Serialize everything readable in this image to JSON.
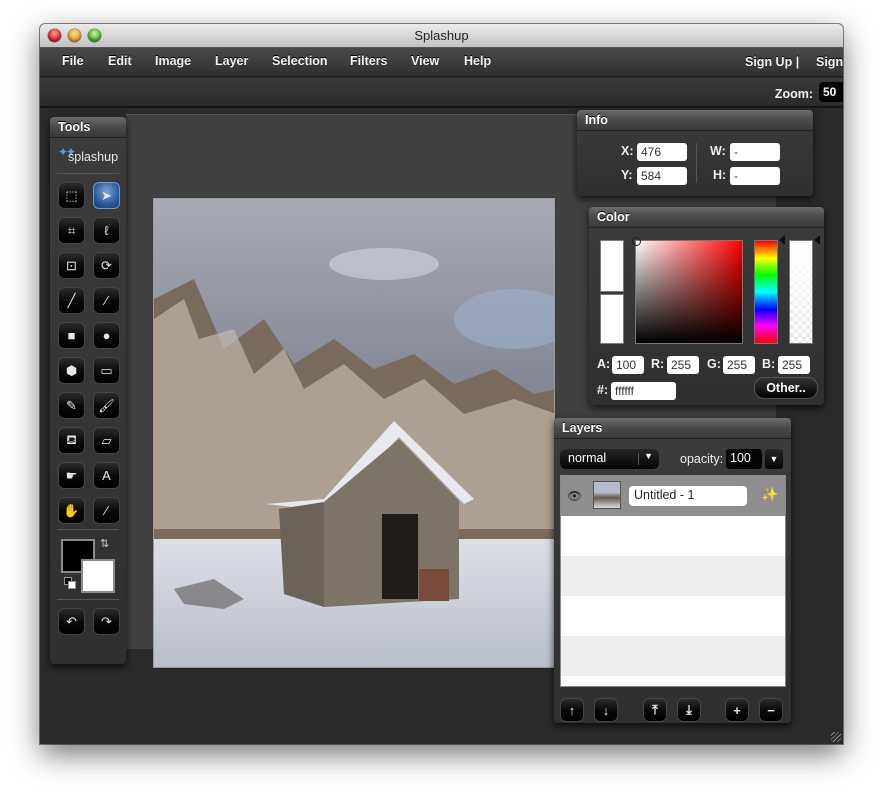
{
  "window": {
    "title": "Splashup"
  },
  "menu": {
    "items": [
      {
        "label": "File"
      },
      {
        "label": "Edit"
      },
      {
        "label": "Image"
      },
      {
        "label": "Layer"
      },
      {
        "label": "Selection"
      },
      {
        "label": "Filters"
      },
      {
        "label": "View"
      },
      {
        "label": "Help"
      }
    ],
    "sign_up": "Sign Up |",
    "sign_in": "Sign"
  },
  "toolbar": {
    "zoom_label": "Zoom:",
    "zoom_value": "50"
  },
  "tools_panel": {
    "title": "Tools",
    "logo_text": "splashup",
    "tools": [
      {
        "name": "marquee-select",
        "icon": "marquee-icon",
        "glyph": "⬚",
        "active": false
      },
      {
        "name": "move-pointer",
        "icon": "pointer-arrow-icon",
        "glyph": "➤",
        "active": true
      },
      {
        "name": "crop",
        "icon": "crop-icon",
        "glyph": "⌗",
        "active": false
      },
      {
        "name": "lasso",
        "icon": "lasso-icon",
        "glyph": "ℓ",
        "active": false
      },
      {
        "name": "transform",
        "icon": "transform-icon",
        "glyph": "⊡",
        "active": false
      },
      {
        "name": "rotate",
        "icon": "rotate-icon",
        "glyph": "⟳",
        "active": false
      },
      {
        "name": "brush",
        "icon": "brush-icon",
        "glyph": "╱",
        "active": false
      },
      {
        "name": "line",
        "icon": "line-icon",
        "glyph": "⁄",
        "active": false
      },
      {
        "name": "rectangle",
        "icon": "rectangle-icon",
        "glyph": "■",
        "active": false
      },
      {
        "name": "ellipse",
        "icon": "ellipse-icon",
        "glyph": "●",
        "active": false
      },
      {
        "name": "polygon",
        "icon": "hexagon-icon",
        "glyph": "⬢",
        "active": false
      },
      {
        "name": "gradient",
        "icon": "gradient-icon",
        "glyph": "▭",
        "active": false
      },
      {
        "name": "pencil",
        "icon": "pencil-icon",
        "glyph": "✎",
        "active": false
      },
      {
        "name": "paintbrush",
        "icon": "paintbrush-icon",
        "glyph": "🖌",
        "active": false
      },
      {
        "name": "paint-bucket",
        "icon": "bucket-icon",
        "glyph": "⛾",
        "active": false
      },
      {
        "name": "eraser",
        "icon": "eraser-icon",
        "glyph": "▱",
        "active": false
      },
      {
        "name": "smudge",
        "icon": "smudge-finger-icon",
        "glyph": "☛",
        "active": false
      },
      {
        "name": "text",
        "icon": "text-icon",
        "glyph": "A",
        "active": false
      },
      {
        "name": "hand",
        "icon": "hand-icon",
        "glyph": "✋",
        "active": false
      },
      {
        "name": "eyedropper",
        "icon": "eyedropper-icon",
        "glyph": "⁄",
        "active": false
      }
    ],
    "foreground_color": "#000000",
    "background_color": "#ffffff",
    "undo_glyph": "↶",
    "redo_glyph": "↷",
    "swap_glyph": "⇅"
  },
  "info_panel": {
    "title": "Info",
    "x_label": "X:",
    "x_value": "476",
    "y_label": "Y:",
    "y_value": "584",
    "w_label": "W:",
    "w_value": "-",
    "h_label": "H:",
    "h_value": "-"
  },
  "color_panel": {
    "title": "Color",
    "a_label": "A:",
    "a_value": "100",
    "r_label": "R:",
    "r_value": "255",
    "g_label": "G:",
    "g_value": "255",
    "b_label": "B:",
    "b_value": "255",
    "hex_label": "#:",
    "hex_value": "ffffff",
    "other_button": "Other..",
    "hue_color": "#ff0000"
  },
  "layers_panel": {
    "title": "Layers",
    "blend_mode": "normal",
    "opacity_label": "opacity:",
    "opacity_value": "100",
    "layers": [
      {
        "name": "Untitled - 1",
        "visible": true,
        "selected": true
      }
    ],
    "buttons": [
      {
        "name": "move-layer-up",
        "icon": "arrow-up-icon",
        "glyph": "↑"
      },
      {
        "name": "move-layer-down",
        "icon": "arrow-down-icon",
        "glyph": "↓"
      },
      {
        "name": "move-layer-top",
        "icon": "arrow-top-icon",
        "glyph": "⤒"
      },
      {
        "name": "move-layer-bottom",
        "icon": "arrow-bottom-icon",
        "glyph": "⤓"
      },
      {
        "name": "add-layer",
        "icon": "plus-icon",
        "glyph": "+"
      },
      {
        "name": "delete-layer",
        "icon": "minus-icon",
        "glyph": "−"
      }
    ]
  }
}
